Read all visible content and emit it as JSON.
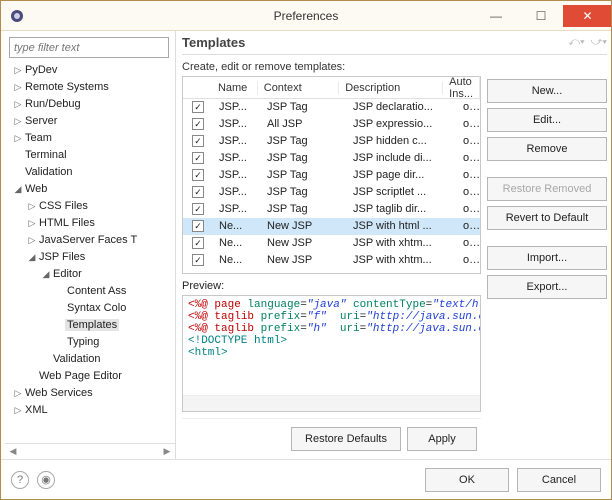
{
  "window": {
    "title": "Preferences"
  },
  "filter": {
    "placeholder": "type filter text"
  },
  "tree": {
    "items": [
      {
        "label": "PyDev",
        "expand": "▷",
        "depth": 0
      },
      {
        "label": "Remote Systems",
        "expand": "▷",
        "depth": 0
      },
      {
        "label": "Run/Debug",
        "expand": "▷",
        "depth": 0
      },
      {
        "label": "Server",
        "expand": "▷",
        "depth": 0
      },
      {
        "label": "Team",
        "expand": "▷",
        "depth": 0
      },
      {
        "label": "Terminal",
        "expand": "",
        "depth": 0
      },
      {
        "label": "Validation",
        "expand": "",
        "depth": 0
      },
      {
        "label": "Web",
        "expand": "◢",
        "depth": 0
      },
      {
        "label": "CSS Files",
        "expand": "▷",
        "depth": 1
      },
      {
        "label": "HTML Files",
        "expand": "▷",
        "depth": 1
      },
      {
        "label": "JavaServer Faces T",
        "expand": "▷",
        "depth": 1
      },
      {
        "label": "JSP Files",
        "expand": "◢",
        "depth": 1
      },
      {
        "label": "Editor",
        "expand": "◢",
        "depth": 2
      },
      {
        "label": "Content Ass",
        "expand": "",
        "depth": 3
      },
      {
        "label": "Syntax Colo",
        "expand": "",
        "depth": 3
      },
      {
        "label": "Templates",
        "expand": "",
        "depth": 3,
        "selected": true
      },
      {
        "label": "Typing",
        "expand": "",
        "depth": 3
      },
      {
        "label": "Validation",
        "expand": "",
        "depth": 2
      },
      {
        "label": "Web Page Editor",
        "expand": "",
        "depth": 1
      },
      {
        "label": "Web Services",
        "expand": "▷",
        "depth": 0
      },
      {
        "label": "XML",
        "expand": "▷",
        "depth": 0
      }
    ]
  },
  "header": {
    "title": "Templates"
  },
  "caption": "Create, edit or remove templates:",
  "table": {
    "columns": [
      "",
      "Name",
      "Context",
      "Description",
      "Auto Ins..."
    ],
    "rows": [
      {
        "checked": true,
        "name": "JSP...",
        "context": "JSP Tag",
        "desc": "JSP declaratio...",
        "auto": "on"
      },
      {
        "checked": true,
        "name": "JSP...",
        "context": "All JSP",
        "desc": "JSP expressio...",
        "auto": "on"
      },
      {
        "checked": true,
        "name": "JSP...",
        "context": "JSP Tag",
        "desc": "JSP hidden c...",
        "auto": "on"
      },
      {
        "checked": true,
        "name": "JSP...",
        "context": "JSP Tag",
        "desc": "JSP include di...",
        "auto": "on"
      },
      {
        "checked": true,
        "name": "JSP...",
        "context": "JSP Tag",
        "desc": "JSP page dir...",
        "auto": "on"
      },
      {
        "checked": true,
        "name": "JSP...",
        "context": "JSP Tag",
        "desc": "JSP scriptlet ...",
        "auto": "on"
      },
      {
        "checked": true,
        "name": "JSP...",
        "context": "JSP Tag",
        "desc": "JSP taglib dir...",
        "auto": "on"
      },
      {
        "checked": true,
        "name": "Ne...",
        "context": "New JSP",
        "desc": "JSP with html ...",
        "auto": "on",
        "selected": true
      },
      {
        "checked": true,
        "name": "Ne...",
        "context": "New JSP",
        "desc": "JSP with xhtm...",
        "auto": "on"
      },
      {
        "checked": true,
        "name": "Ne...",
        "context": "New JSP",
        "desc": "JSP with xhtm...",
        "auto": "on"
      }
    ]
  },
  "side": {
    "new": "New...",
    "edit": "Edit...",
    "remove": "Remove",
    "restore_removed": "Restore Removed",
    "revert": "Revert to Default",
    "import": "Import...",
    "export": "Export..."
  },
  "preview": {
    "label": "Preview:",
    "line1a": "<%@",
    "line1b": " page ",
    "line1c": "language",
    "line1d": "=",
    "line1e": "\"java\"",
    "line1f": " contentType",
    "line1g": "=",
    "line1h": "\"text/html; char",
    "line2a": "<%@",
    "line2b": " taglib ",
    "line2c": "prefix",
    "line2d": "=",
    "line2e": "\"f\"",
    "line2f": "  uri",
    "line2g": "=",
    "line2h": "\"http://java.sun.com/jsf/c",
    "line3a": "<%@",
    "line3b": " taglib ",
    "line3c": "prefix",
    "line3d": "=",
    "line3e": "\"h\"",
    "line3f": "  uri",
    "line3g": "=",
    "line3h": "\"http://java.sun.com/jsf/h",
    "line4": "<!DOCTYPE html>",
    "line5": "<html>"
  },
  "bottom": {
    "restore": "Restore Defaults",
    "apply": "Apply"
  },
  "footer": {
    "ok": "OK",
    "cancel": "Cancel"
  }
}
